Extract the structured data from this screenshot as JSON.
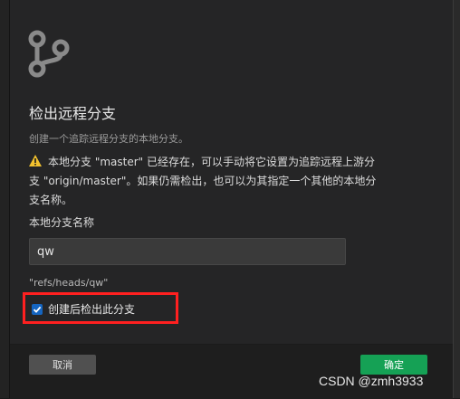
{
  "dialog": {
    "icon": "git-branch-icon",
    "title": "检出远程分支",
    "subtitle": "创建一个追踪远程分支的本地分支。",
    "warning": {
      "icon": "warning-icon",
      "line1": "本地分支 \"master\" 已经存在，可以手动将它设置为追踪远程上游分",
      "line2": "支 \"origin/master\"。如果仍需检出，也可以为其指定一个其他的本地分",
      "line3": "支名称。"
    },
    "field_label": "本地分支名称",
    "field_value": "qw",
    "ref_path": "\"refs/heads/qw\"",
    "checkbox": {
      "label": "创建后检出此分支",
      "checked": true
    },
    "cancel_label": "取消",
    "ok_label": "确定"
  },
  "colors": {
    "accent_green": "#15a155",
    "checkbox_blue": "#1565c0",
    "highlight_red": "#ff2020",
    "warning_yellow": "#f2c12e"
  },
  "watermark": "CSDN @zmh3933"
}
